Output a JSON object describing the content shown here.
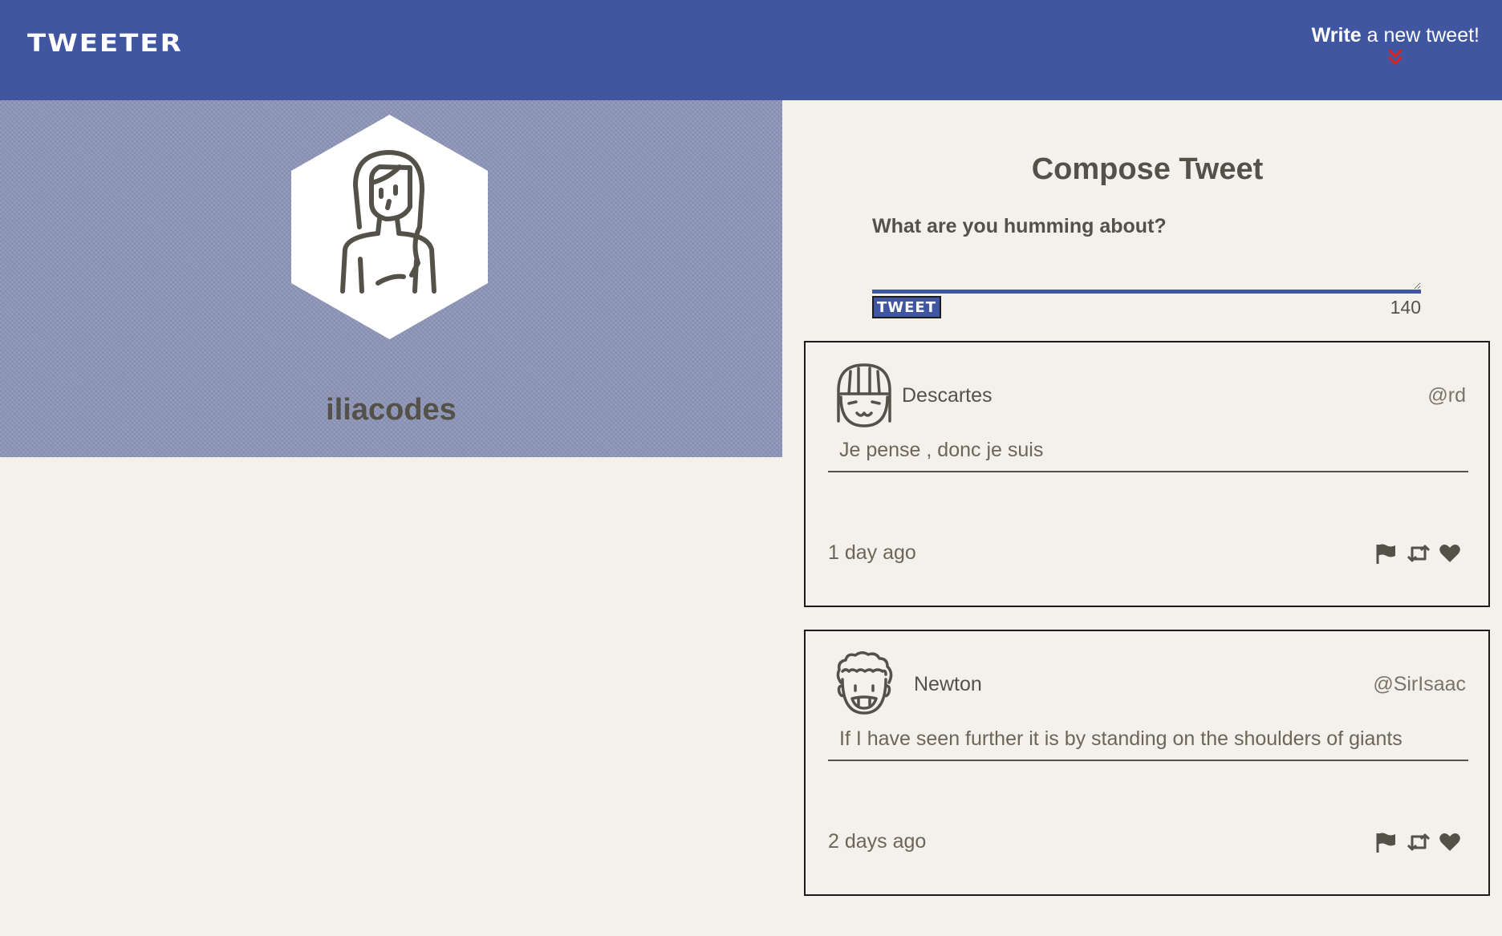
{
  "nav": {
    "brand": "TWEETER",
    "write_strong": "Write",
    "write_rest": " a new tweet!",
    "chevron_icon": "double-chevron-down-icon"
  },
  "profile": {
    "username": "iliacodes",
    "avatar_icon": "girl-avatar-icon"
  },
  "compose": {
    "title": "Compose Tweet",
    "label": "What are you humming about?",
    "value": "",
    "button": "TWEET",
    "counter": "140"
  },
  "tweets": [
    {
      "name": "Descartes",
      "handle": "@rd",
      "content": "Je pense , donc je suis",
      "time": "1 day ago",
      "avatar_icon": "girl-face-avatar-icon"
    },
    {
      "name": "Newton",
      "handle": "@SirIsaac",
      "content": "If I have seen further it is by standing on the shoulders of giants",
      "time": "2 days ago",
      "avatar_icon": "curly-hair-face-avatar-icon"
    }
  ],
  "colors": {
    "nav": "#4056a1",
    "background": "#f4f1ec",
    "profile": "#8d95b8",
    "text": "#545149",
    "chevron": "#e0221b"
  }
}
